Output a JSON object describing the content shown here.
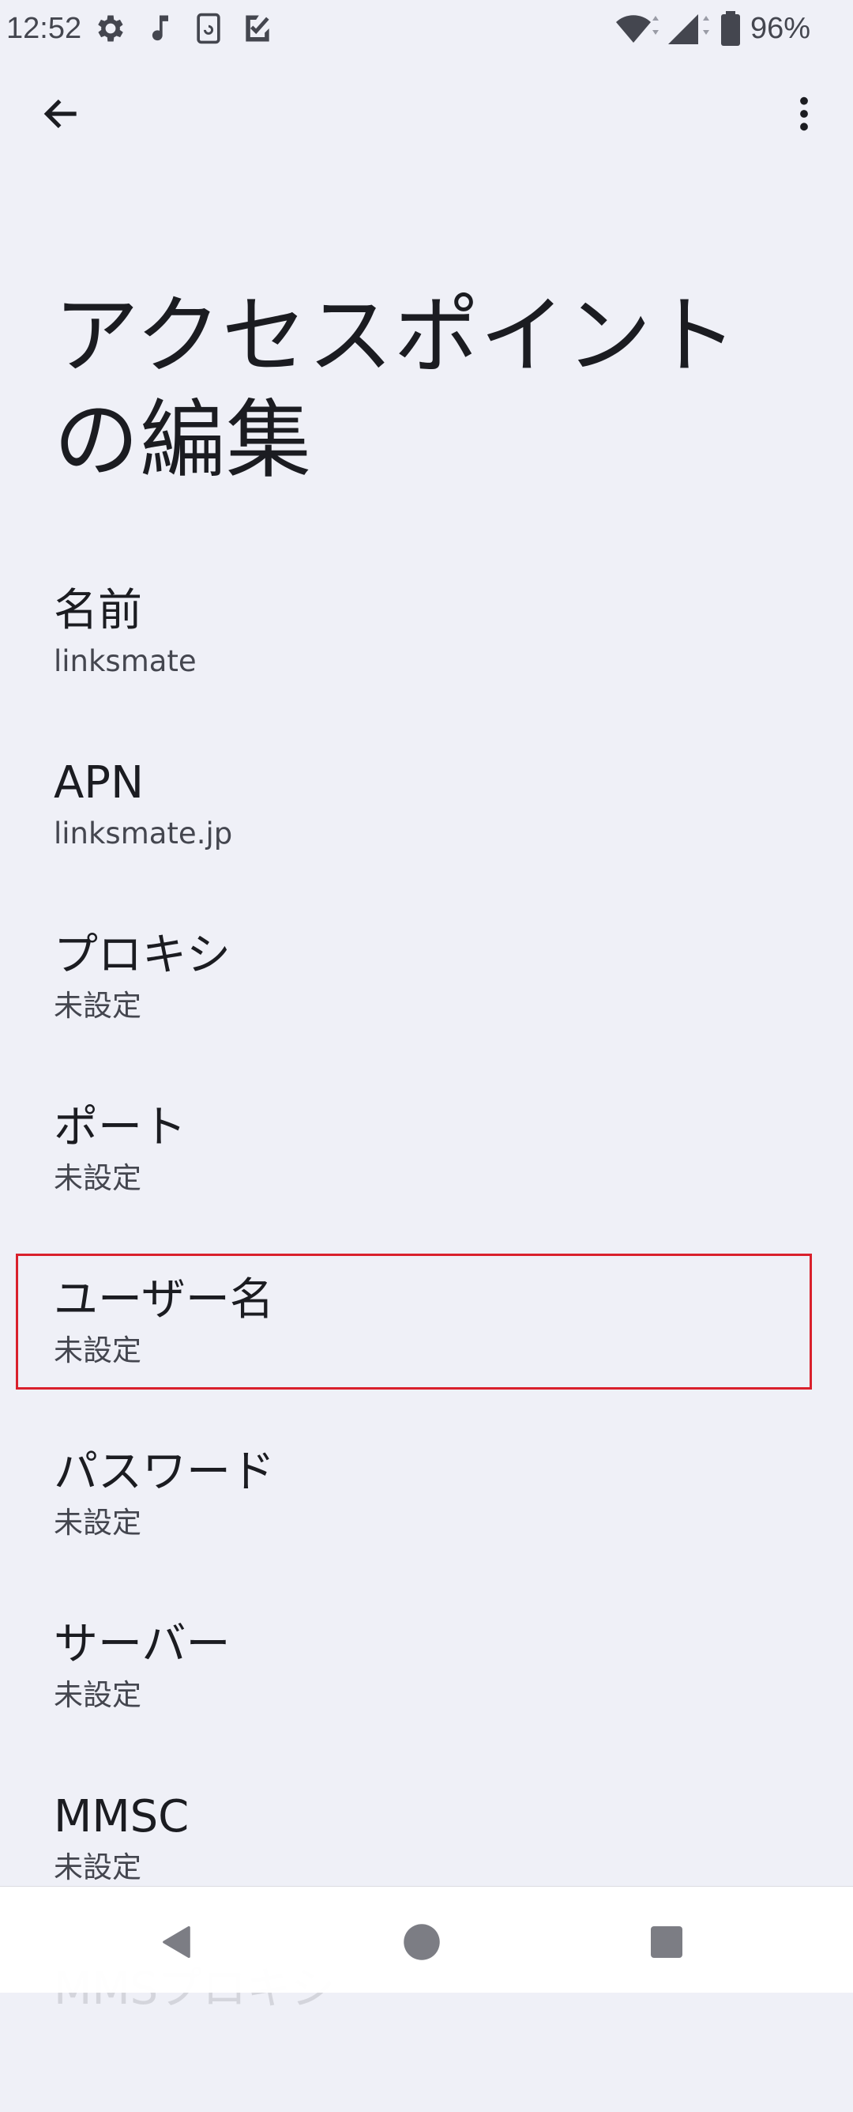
{
  "status_bar": {
    "time": "12:52",
    "battery_percent": "96%",
    "icons": [
      "settings-icon",
      "music-note-icon",
      "sim-card-icon",
      "checkbox-icon",
      "wifi-icon",
      "cell-signal-icon",
      "battery-icon"
    ]
  },
  "app_bar": {
    "back_icon": "arrow-back-icon",
    "menu_icon": "more-vert-icon"
  },
  "page": {
    "title": "アクセスポイントの編集"
  },
  "preferences": [
    {
      "title": "名前",
      "summary": "linksmate"
    },
    {
      "title": "APN",
      "summary": "linksmate.jp"
    },
    {
      "title": "プロキシ",
      "summary": "未設定"
    },
    {
      "title": "ポート",
      "summary": "未設定"
    },
    {
      "title": "ユーザー名",
      "summary": "未設定"
    },
    {
      "title": "パスワード",
      "summary": "未設定"
    },
    {
      "title": "サーバー",
      "summary": "未設定"
    },
    {
      "title": "MMSC",
      "summary": "未設定"
    },
    {
      "title": "MMSプロキシ",
      "summary": ""
    }
  ],
  "nav_bar": {
    "back": "nav-back-icon",
    "home": "nav-home-icon",
    "recents": "nav-recents-icon"
  },
  "colors": {
    "background": "#eff0f7",
    "highlight_border": "#d9202c",
    "text_primary": "#1b1c21",
    "text_secondary": "#44464f"
  }
}
